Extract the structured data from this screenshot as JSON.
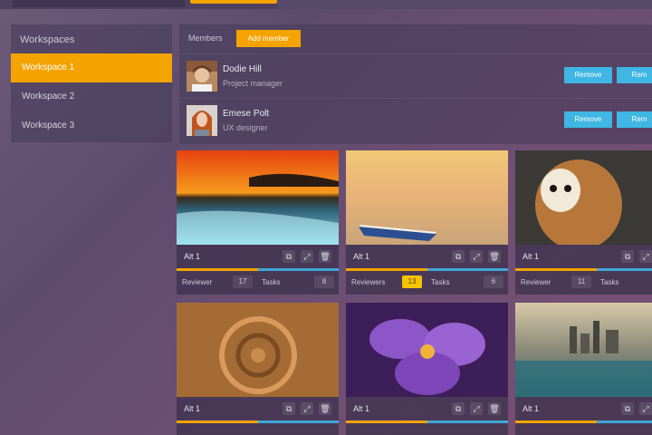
{
  "sidebar": {
    "title": "Workspaces",
    "items": [
      {
        "label": "Workspace 1",
        "active": true
      },
      {
        "label": "Workspace 2",
        "active": false
      },
      {
        "label": "Workspace 3",
        "active": false
      }
    ]
  },
  "members": {
    "header_label": "Members",
    "add_label": "Add member",
    "list": [
      {
        "name": "Dodie Hill",
        "role": "Project manager",
        "remove_label": "Remove",
        "second_label": "Rem"
      },
      {
        "name": "Emese Polt",
        "role": "UX designer",
        "remove_label": "Remove",
        "second_label": "Rem"
      }
    ]
  },
  "cards": [
    {
      "title": "Alt 1",
      "progress": 0.5,
      "reviewers_label": "Reviewer",
      "reviewers": "17",
      "tasks_label": "Tasks",
      "tasks": "8"
    },
    {
      "title": "Alt 1",
      "progress": 0.5,
      "reviewers_label": "Reviewers",
      "reviewers": "13",
      "tasks_label": "Tasks",
      "tasks": "6",
      "highlight": true
    },
    {
      "title": "Alt 1",
      "progress": 0.5,
      "reviewers_label": "Reviewer",
      "reviewers": "11",
      "tasks_label": "Tasks",
      "tasks": ""
    },
    {
      "title": "Alt 1",
      "progress": 0.5
    },
    {
      "title": "Alt 1",
      "progress": 0.5
    },
    {
      "title": "Alt 1",
      "progress": 0.5
    }
  ],
  "colors": {
    "accent": "#f5a300",
    "action": "#3fb6e3"
  }
}
